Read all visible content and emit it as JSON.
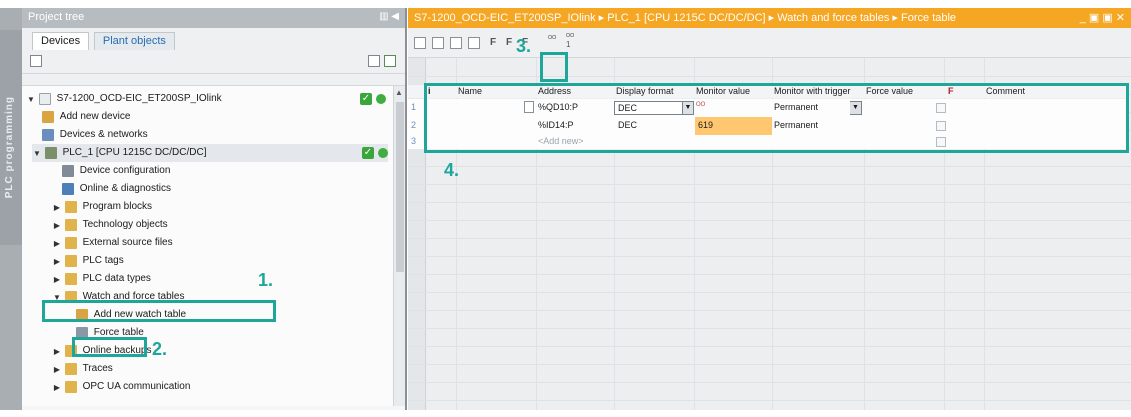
{
  "sidebar_strip": {
    "label": "PLC programming"
  },
  "project_tree": {
    "title": "Project tree",
    "tabs": [
      "Devices",
      "Plant objects"
    ],
    "items": [
      {
        "label": "S7-1200_OCD-EIC_ET200SP_IOlink",
        "level": 0,
        "expanded": true,
        "icon": "project-icon"
      },
      {
        "label": "Add new device",
        "level": 1,
        "icon": "add-device-icon"
      },
      {
        "label": "Devices & networks",
        "level": 1,
        "icon": "network-icon"
      },
      {
        "label": "PLC_1 [CPU 1215C DC/DC/DC]",
        "level": 1,
        "expanded": true,
        "icon": "plc-icon"
      },
      {
        "label": "Device configuration",
        "level": 2,
        "icon": "device-config-icon"
      },
      {
        "label": "Online & diagnostics",
        "level": 2,
        "icon": "diagnostics-icon"
      },
      {
        "label": "Program blocks",
        "level": 2,
        "expanded": false,
        "icon": "folder-icon"
      },
      {
        "label": "Technology objects",
        "level": 2,
        "expanded": false,
        "icon": "folder-icon"
      },
      {
        "label": "External source files",
        "level": 2,
        "expanded": false,
        "icon": "folder-icon"
      },
      {
        "label": "PLC tags",
        "level": 2,
        "expanded": false,
        "icon": "folder-icon"
      },
      {
        "label": "PLC data types",
        "level": 2,
        "expanded": false,
        "icon": "folder-icon"
      },
      {
        "label": "Watch and force tables",
        "level": 2,
        "expanded": true,
        "icon": "folder-icon"
      },
      {
        "label": "Add new watch table",
        "level": 3,
        "icon": "add-table-icon"
      },
      {
        "label": "Force table",
        "level": 3,
        "icon": "force-table-icon"
      },
      {
        "label": "Online backups",
        "level": 2,
        "expanded": false,
        "icon": "folder-icon"
      },
      {
        "label": "Traces",
        "level": 2,
        "expanded": false,
        "icon": "folder-icon"
      },
      {
        "label": "OPC UA communication",
        "level": 2,
        "expanded": false,
        "icon": "folder-icon"
      }
    ]
  },
  "editor": {
    "breadcrumb": [
      "S7-1200_OCD-EIC_ET200SP_IOlink",
      "PLC_1 [CPU 1215C DC/DC/DC]",
      "Watch and force tables",
      "Force table"
    ],
    "breadcrumb_sep": "▸",
    "window_controls": "_ ▣ ▣ ✕",
    "toolbar_icons": [
      "insert-row-icon",
      "add-row-icon",
      "sort-icon",
      "show-hide-icon",
      "force-icon",
      "force-all-icon",
      "stop-force-icon",
      "monitor-all-icon",
      "monitor-once-icon"
    ],
    "toolbar_text": {
      "f1": "F",
      "f2": "F",
      "f3": "F",
      "m1": "ᴼᴼ",
      "m2": "ᴼᴼ\n1"
    },
    "table": {
      "columns": [
        "i",
        "Name",
        "Address",
        "Display format",
        "Monitor value",
        "Monitor with trigger",
        "Force value",
        "F",
        "Comment"
      ],
      "rows": [
        {
          "num": "1",
          "name": "",
          "address": "%QD10:P",
          "display_format": "DEC",
          "monitor_value": "",
          "monitor_trigger": "Permanent",
          "force_value": "",
          "comment": ""
        },
        {
          "num": "2",
          "name": "",
          "address": "%ID14:P",
          "display_format": "DEC",
          "monitor_value": "619",
          "monitor_trigger": "Permanent",
          "force_value": "",
          "comment": ""
        },
        {
          "num": "3",
          "name": "",
          "address": "<Add new>",
          "display_format": "",
          "monitor_value": "",
          "monitor_trigger": "",
          "force_value": "",
          "comment": ""
        }
      ]
    }
  },
  "annotations": {
    "step1": "1.",
    "step2": "2.",
    "step3": "3.",
    "step4": "4."
  },
  "colors": {
    "accent": "#1fa69b",
    "title_bar": "#f5a623",
    "highlight_cell": "#ffc870"
  }
}
